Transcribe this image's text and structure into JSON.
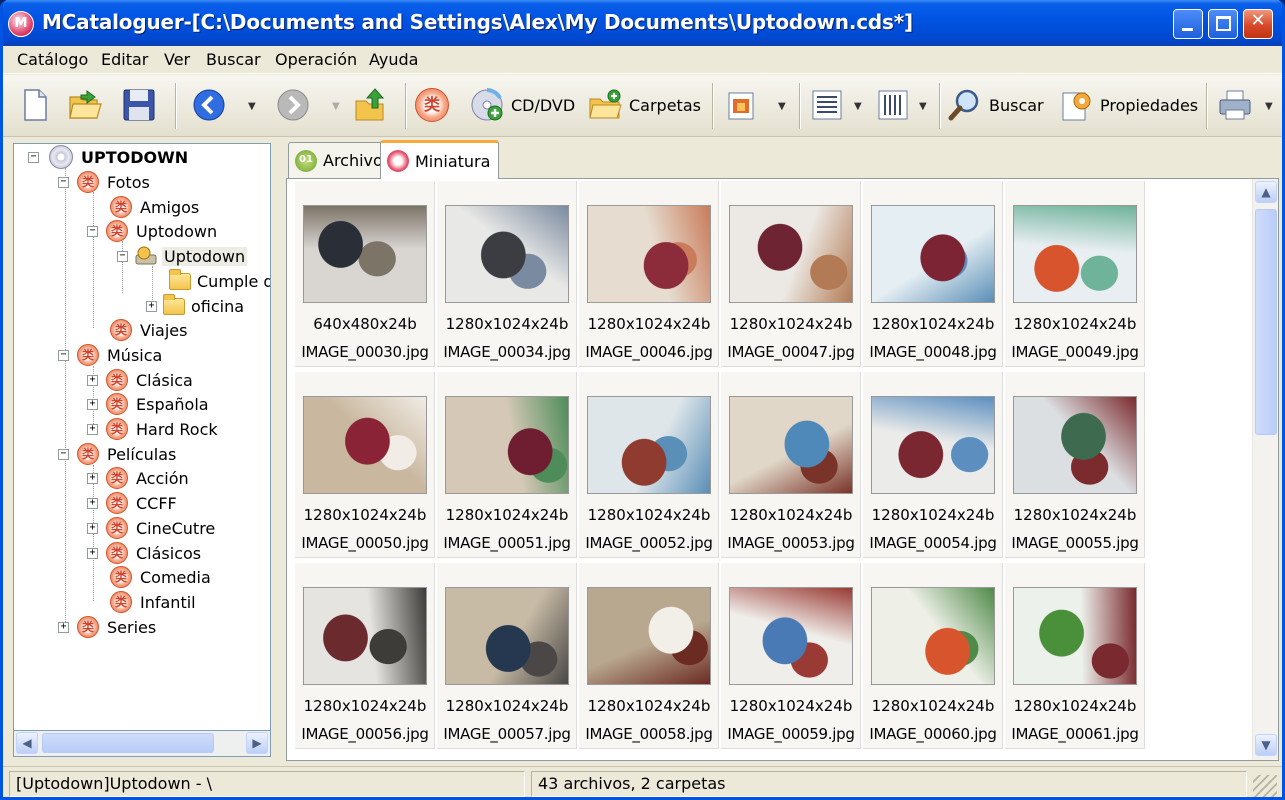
{
  "window": {
    "title": "MCataloguer-[C:\\Documents and Settings\\Alex\\My Documents\\Uptodown.cds*]"
  },
  "menu": [
    "Catálogo",
    "Editar",
    "Ver",
    "Buscar",
    "Operación",
    "Ayuda"
  ],
  "toolbar": {
    "cd_label": "CD/DVD",
    "folders_label": "Carpetas",
    "search_label": "Buscar",
    "properties_label": "Propiedades"
  },
  "tree": {
    "root": "UPTODOWN",
    "fotos": "Fotos",
    "amigos": "Amigos",
    "uptodown": "Uptodown",
    "uptodown_disk": "Uptodown",
    "cumple": "Cumple de",
    "oficina": "oficina",
    "viajes": "Viajes",
    "musica": "Música",
    "clasica": "Clásica",
    "espanola": "Española",
    "hardrock": "Hard Rock",
    "peliculas": "Películas",
    "accion": "Acción",
    "ccff": "CCFF",
    "cinecutre": "CineCutre",
    "clasicos": "Clásicos",
    "comedia": "Comedia",
    "infantil": "Infantil",
    "series": "Series"
  },
  "tabs": {
    "archivo": "Archivo",
    "miniatura": "Miniatura"
  },
  "thumbnails": [
    {
      "dims": "640x480x24b",
      "name": "IMAGE_00030.jpg",
      "colors": [
        "#d9d6d2",
        "#2a2f37",
        "#7d7468"
      ]
    },
    {
      "dims": "1280x1024x24b",
      "name": "IMAGE_00034.jpg",
      "colors": [
        "#e8e8e6",
        "#3b3d42",
        "#7a8aa0"
      ]
    },
    {
      "dims": "1280x1024x24b",
      "name": "IMAGE_00046.jpg",
      "colors": [
        "#e6ddd0",
        "#8c2b3a",
        "#c97b5a"
      ]
    },
    {
      "dims": "1280x1024x24b",
      "name": "IMAGE_00047.jpg",
      "colors": [
        "#ece9e4",
        "#6e2432",
        "#b37b55"
      ]
    },
    {
      "dims": "1280x1024x24b",
      "name": "IMAGE_00048.jpg",
      "colors": [
        "#e5eef3",
        "#7c2334",
        "#5a8fb7"
      ]
    },
    {
      "dims": "1280x1024x24b",
      "name": "IMAGE_00049.jpg",
      "colors": [
        "#e8eef2",
        "#d8542c",
        "#6fb39a"
      ]
    },
    {
      "dims": "1280x1024x24b",
      "name": "IMAGE_00050.jpg",
      "colors": [
        "#c9b89f",
        "#8a2336",
        "#f1ece6"
      ]
    },
    {
      "dims": "1280x1024x24b",
      "name": "IMAGE_00051.jpg",
      "colors": [
        "#d5c8b6",
        "#6e1e30",
        "#4e8d5a"
      ]
    },
    {
      "dims": "1280x1024x24b",
      "name": "IMAGE_00052.jpg",
      "colors": [
        "#dfe6ea",
        "#8f3b2f",
        "#5a8fb7"
      ]
    },
    {
      "dims": "1280x1024x24b",
      "name": "IMAGE_00053.jpg",
      "colors": [
        "#e0d7c8",
        "#4f89b9",
        "#7a3328"
      ]
    },
    {
      "dims": "1280x1024x24b",
      "name": "IMAGE_00054.jpg",
      "colors": [
        "#ebebe9",
        "#7a2731",
        "#5c8fc0"
      ]
    },
    {
      "dims": "1280x1024x24b",
      "name": "IMAGE_00055.jpg",
      "colors": [
        "#dcdfe2",
        "#3e6b50",
        "#7b2a2d"
      ]
    },
    {
      "dims": "1280x1024x24b",
      "name": "IMAGE_00056.jpg",
      "colors": [
        "#e6e4e0",
        "#6a2a2e",
        "#3e3c39"
      ]
    },
    {
      "dims": "1280x1024x24b",
      "name": "IMAGE_00057.jpg",
      "colors": [
        "#c7bba6",
        "#26384f",
        "#4a4746"
      ]
    },
    {
      "dims": "1280x1024x24b",
      "name": "IMAGE_00058.jpg",
      "colors": [
        "#b9a890",
        "#f2eee8",
        "#6b2a22"
      ]
    },
    {
      "dims": "1280x1024x24b",
      "name": "IMAGE_00059.jpg",
      "colors": [
        "#f0eeea",
        "#4a7ab6",
        "#9a3a34"
      ]
    },
    {
      "dims": "1280x1024x24b",
      "name": "IMAGE_00060.jpg",
      "colors": [
        "#eef0e8",
        "#d8542c",
        "#4f8a48"
      ]
    },
    {
      "dims": "1280x1024x24b",
      "name": "IMAGE_00061.jpg",
      "colors": [
        "#edf1ec",
        "#4a8f3a",
        "#7a2a2e"
      ]
    }
  ],
  "status": {
    "path": "[Uptodown]Uptodown - \\",
    "count": "43 archivos, 2 carpetas"
  },
  "colors": {
    "titlebar": "#0054e3",
    "window_bg": "#ece9d8",
    "tab_highlight": "#f9a93a"
  }
}
